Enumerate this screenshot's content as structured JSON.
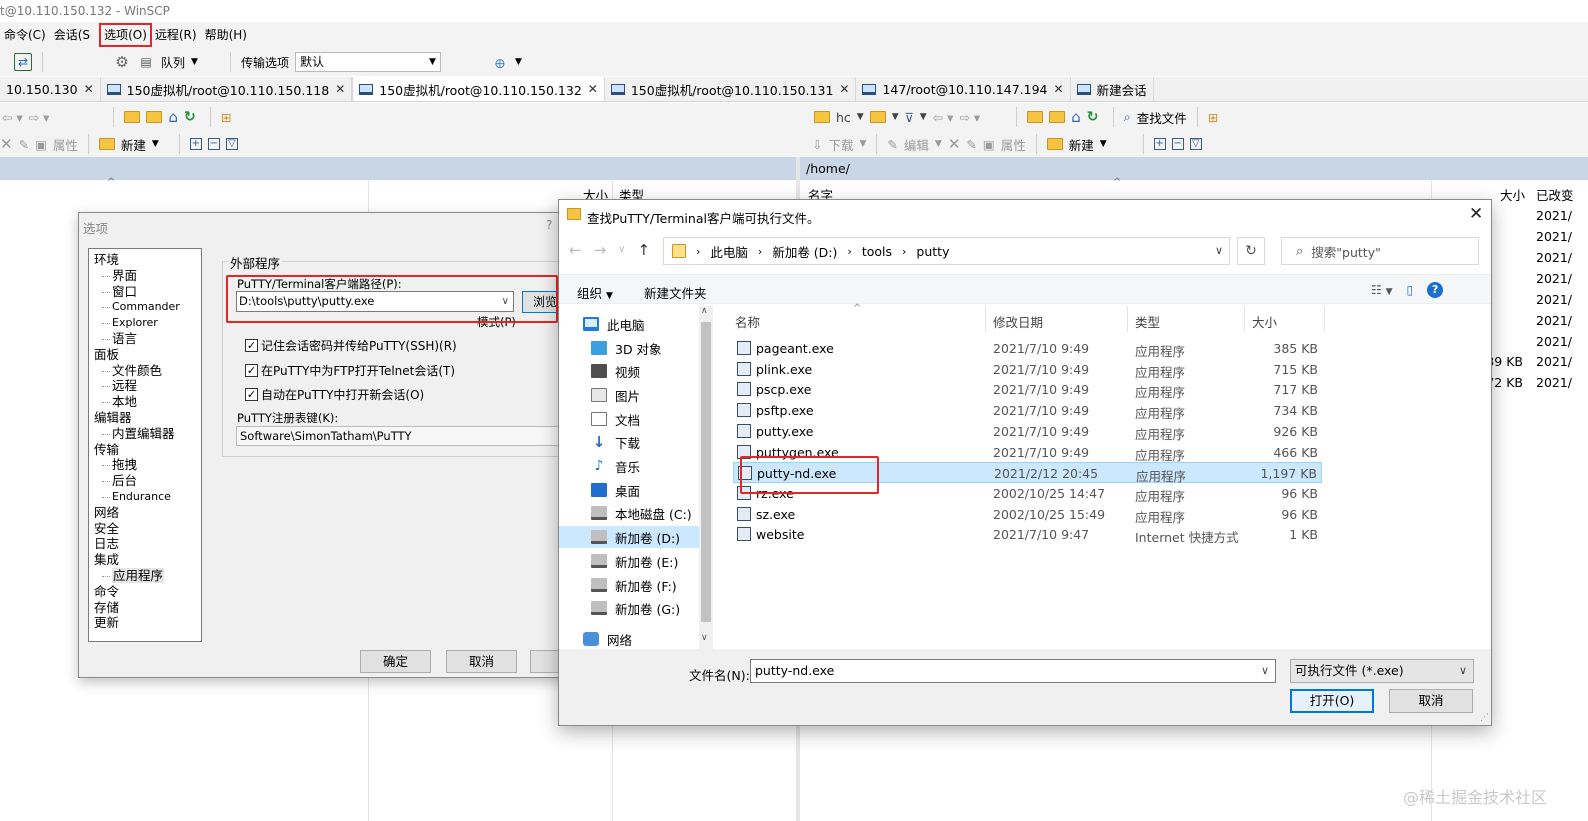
{
  "window": {
    "title": "t@10.110.150.132 - WinSCP"
  },
  "menu": [
    "命令(C)",
    "会话(S",
    "选项(O)",
    "远程(R)",
    "帮助(H)"
  ],
  "toolbar1": {
    "queue_label": "队列",
    "transfer_label": "传输选项",
    "transfer_value": "默认"
  },
  "tabs": [
    {
      "label": "10.150.130",
      "active": false
    },
    {
      "label": "150虚拟机/root@10.110.150.118",
      "active": false
    },
    {
      "label": "150虚拟机/root@10.110.150.132",
      "active": true
    },
    {
      "label": "150虚拟机/root@10.110.150.131",
      "active": false
    },
    {
      "label": "147/root@10.110.147.194",
      "active": false
    },
    {
      "label": "新建会话",
      "active": false
    }
  ],
  "left_panel": {
    "properties_label": "属性",
    "new_label": "新建",
    "col_size": "大小",
    "col_type": "类型"
  },
  "right_panel": {
    "path_combo": "hc",
    "find_files_label": "查找文件",
    "download_label": "下载",
    "edit_label": "编辑",
    "properties_label": "属性",
    "new_label": "新建",
    "path": "/home/",
    "col_name": "名字",
    "col_size": "大小",
    "col_changed": "已改变",
    "dates": [
      "2021/",
      "2021/",
      "2021/",
      "2021/",
      "2021/",
      "2021/",
      "2021/",
      "2021/",
      "2021/"
    ],
    "sizes": [
      "39 KB",
      "72 KB"
    ]
  },
  "options_dialog": {
    "title": "选项",
    "help_mark": "?",
    "tree": [
      {
        "label": "环境",
        "level": 0
      },
      {
        "label": "界面",
        "level": 1
      },
      {
        "label": "窗口",
        "level": 1
      },
      {
        "label": "Commander",
        "level": 1
      },
      {
        "label": "Explorer",
        "level": 1
      },
      {
        "label": "语言",
        "level": 1
      },
      {
        "label": "面板",
        "level": 0
      },
      {
        "label": "文件颜色",
        "level": 1
      },
      {
        "label": "远程",
        "level": 1
      },
      {
        "label": "本地",
        "level": 1
      },
      {
        "label": "编辑器",
        "level": 0
      },
      {
        "label": "内置编辑器",
        "level": 1
      },
      {
        "label": "传输",
        "level": 0
      },
      {
        "label": "拖拽",
        "level": 1
      },
      {
        "label": "后台",
        "level": 1
      },
      {
        "label": "Endurance",
        "level": 1
      },
      {
        "label": "网络",
        "level": 0
      },
      {
        "label": "安全",
        "level": 0
      },
      {
        "label": "日志",
        "level": 0
      },
      {
        "label": "集成",
        "level": 0
      },
      {
        "label": "应用程序",
        "level": 1,
        "selected": true
      },
      {
        "label": "命令",
        "level": 0
      },
      {
        "label": "存储",
        "level": 0
      },
      {
        "label": "更新",
        "level": 0
      }
    ],
    "group_label": "外部程序",
    "putty_path_label": "PuTTY/Terminal客户端路径(P):",
    "putty_path_value": "D:\\tools\\putty\\putty.exe",
    "browse_label": "浏览",
    "pattern_label": "模式(P)",
    "checkboxes": [
      {
        "label": "记住会话密码并传给PuTTY(SSH)(R)",
        "checked": true
      },
      {
        "label": "在PuTTY中为FTP打开Telnet会话(T)",
        "checked": true
      },
      {
        "label": "自动在PuTTY中打开新会话(O)",
        "checked": true
      }
    ],
    "regkey_label": "PuTTY注册表键(K):",
    "regkey_value": "Software\\SimonTatham\\PuTTY",
    "ok_label": "确定",
    "cancel_label": "取消"
  },
  "file_dialog": {
    "title": "查找PuTTY/Terminal客户端可执行文件。",
    "breadcrumb": [
      "此电脑",
      "新加卷 (D:)",
      "tools",
      "putty"
    ],
    "search_placeholder": "搜索\"putty\"",
    "organize_label": "组织",
    "new_folder_label": "新建文件夹",
    "nav_items": [
      {
        "label": "此电脑",
        "icon": "pc",
        "level": 0
      },
      {
        "label": "3D 对象",
        "icon": "3d",
        "level": 1
      },
      {
        "label": "视频",
        "icon": "video",
        "level": 1
      },
      {
        "label": "图片",
        "icon": "pic",
        "level": 1
      },
      {
        "label": "文档",
        "icon": "doc",
        "level": 1
      },
      {
        "label": "下载",
        "icon": "down",
        "level": 1
      },
      {
        "label": "音乐",
        "icon": "music",
        "level": 1
      },
      {
        "label": "桌面",
        "icon": "desk",
        "level": 1
      },
      {
        "label": "本地磁盘 (C:)",
        "icon": "drive",
        "level": 1
      },
      {
        "label": "新加卷 (D:)",
        "icon": "drive",
        "level": 1,
        "selected": true
      },
      {
        "label": "新加卷 (E:)",
        "icon": "drive",
        "level": 1
      },
      {
        "label": "新加卷 (F:)",
        "icon": "drive",
        "level": 1
      },
      {
        "label": "新加卷 (G:)",
        "icon": "drive",
        "level": 1
      },
      {
        "label": "网络",
        "icon": "net",
        "level": 0
      }
    ],
    "columns": {
      "name": "名称",
      "date": "修改日期",
      "type": "类型",
      "size": "大小"
    },
    "files": [
      {
        "name": "pageant.exe",
        "date": "2021/7/10 9:49",
        "type": "应用程序",
        "size": "385 KB"
      },
      {
        "name": "plink.exe",
        "date": "2021/7/10 9:49",
        "type": "应用程序",
        "size": "715 KB"
      },
      {
        "name": "pscp.exe",
        "date": "2021/7/10 9:49",
        "type": "应用程序",
        "size": "717 KB"
      },
      {
        "name": "psftp.exe",
        "date": "2021/7/10 9:49",
        "type": "应用程序",
        "size": "734 KB"
      },
      {
        "name": "putty.exe",
        "date": "2021/7/10 9:49",
        "type": "应用程序",
        "size": "926 KB"
      },
      {
        "name": "puttygen.exe",
        "date": "2021/7/10 9:49",
        "type": "应用程序",
        "size": "466 KB"
      },
      {
        "name": "putty-nd.exe",
        "date": "2021/2/12 20:45",
        "type": "应用程序",
        "size": "1,197 KB",
        "selected": true
      },
      {
        "name": "rz.exe",
        "date": "2002/10/25 14:47",
        "type": "应用程序",
        "size": "96 KB"
      },
      {
        "name": "sz.exe",
        "date": "2002/10/25 15:49",
        "type": "应用程序",
        "size": "96 KB"
      },
      {
        "name": "website",
        "date": "2021/7/10 9:47",
        "type": "Internet 快捷方式",
        "size": "1 KB"
      }
    ],
    "filename_label": "文件名(N):",
    "filename_value": "putty-nd.exe",
    "filter_value": "可执行文件 (*.exe)",
    "open_label": "打开(O)",
    "cancel_label": "取消"
  },
  "watermark": "@稀土掘金技术社区",
  "colors": {
    "highlight_red": "#e32626",
    "selection_blue": "#cce8ff",
    "path_bar": "#c8d6e5"
  }
}
